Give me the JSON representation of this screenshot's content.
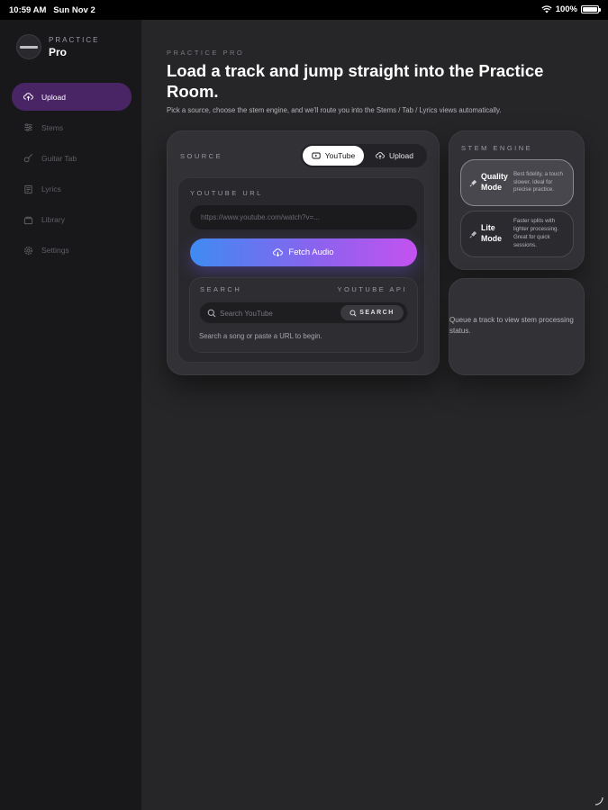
{
  "status_bar": {
    "time": "10:59 AM",
    "date": "Sun Nov 2",
    "battery": "100%"
  },
  "brand": {
    "eyebrow": "PRACTICE",
    "name": "Pro",
    "logo_icon": "brand-logo-icon"
  },
  "nav": [
    {
      "label": "Upload",
      "icon": "upload-cloud-icon",
      "active": true
    },
    {
      "label": "Stems",
      "icon": "sliders-icon",
      "active": false
    },
    {
      "label": "Guitar Tab",
      "icon": "guitar-icon",
      "active": false
    },
    {
      "label": "Lyrics",
      "icon": "lyrics-icon",
      "active": false
    },
    {
      "label": "Library",
      "icon": "library-icon",
      "active": false
    },
    {
      "label": "Settings",
      "icon": "gear-icon",
      "active": false
    }
  ],
  "header": {
    "eyebrow": "PRACTICE PRO",
    "title": "Load a track and jump straight into the Practice Room.",
    "subtitle": "Pick a source, choose the stem engine, and we'll route you into the Stems / Tab / Lyrics views automatically."
  },
  "source": {
    "label": "SOURCE",
    "tabs": [
      {
        "label": "YouTube",
        "icon": "youtube-icon",
        "active": true
      },
      {
        "label": "Upload",
        "icon": "upload-cloud-icon",
        "active": false
      }
    ],
    "url_label": "YOUTUBE URL",
    "url_placeholder": "https://www.youtube.com/watch?v=...",
    "fetch_label": "Fetch Audio",
    "search": {
      "label": "SEARCH",
      "api_label": "YOUTUBE API",
      "placeholder": "Search YouTube",
      "button_label": "SEARCH",
      "hint": "Search a song or paste a URL to begin."
    }
  },
  "stem_engine": {
    "label": "STEM ENGINE",
    "modes": [
      {
        "name": "Quality Mode",
        "description": "Best fidelity, a touch slower. Ideal for precise practice.",
        "icon": "microphone-icon",
        "selected": true
      },
      {
        "name": "Lite Mode",
        "description": "Faster splits with lighter processing. Great for quick sessions.",
        "icon": "microphone-icon",
        "selected": false
      }
    ]
  },
  "status_card": {
    "text": "Queue a track to view stem processing status."
  },
  "colors": {
    "accent_active_nav": "#4a2566",
    "gradient_start": "#3f8bf2",
    "gradient_end": "#c452f0",
    "background": "#262527",
    "sidebar": "#18181a"
  }
}
